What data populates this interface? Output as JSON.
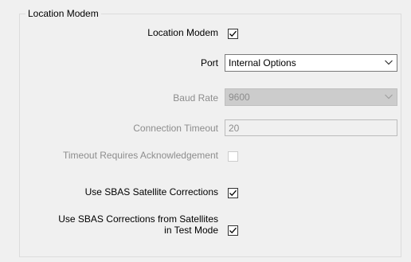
{
  "group": {
    "title": "Location Modem"
  },
  "fields": {
    "location_modem": {
      "label": "Location Modem",
      "checked": true
    },
    "port": {
      "label": "Port",
      "value": "Internal Options"
    },
    "baud_rate": {
      "label": "Baud Rate",
      "value": "9600"
    },
    "connection_timeout": {
      "label": "Connection Timeout",
      "value": "20"
    },
    "timeout_ack": {
      "label": "Timeout Requires Acknowledgement",
      "checked": false
    },
    "use_sbas": {
      "label": "Use SBAS Satellite Corrections",
      "checked": true
    },
    "sbas_test_mode": {
      "label_line1": "Use SBAS Corrections from Satellites",
      "label_line2": "in Test Mode",
      "checked": true
    }
  },
  "icons": {
    "check": "checkmark-icon",
    "dropdown": "chevron-down-icon"
  },
  "colors": {
    "background": "#f0f0f0",
    "disabled_text": "#8d8d8d",
    "disabled_combo": "#cccccc"
  }
}
